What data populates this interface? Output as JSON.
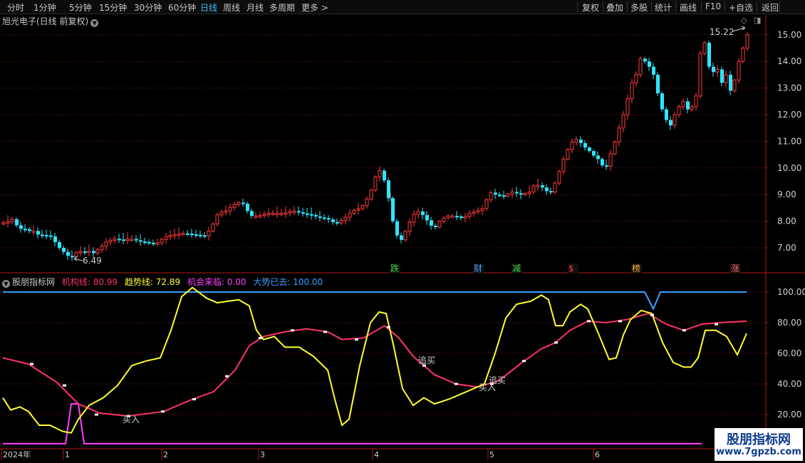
{
  "toolbar": {
    "left": [
      "分时",
      "1分钟",
      "5分钟",
      "15分钟",
      "30分钟",
      "60分钟",
      "日线",
      "周线",
      "月线",
      "多周期",
      "更多 >"
    ],
    "active_index": 6,
    "right": [
      "复权",
      "叠加",
      "多股",
      "统计",
      "画线",
      "F10",
      "+自选",
      "返回"
    ]
  },
  "main_title": "旭光电子(日线 前复权)",
  "price_axis": [
    "15.00",
    "14.00",
    "13.00",
    "12.00",
    "11.00",
    "10.00",
    "9.00",
    "8.00",
    "7.00"
  ],
  "annotations": {
    "high": "15.22",
    "low": "6.49"
  },
  "events": [
    {
      "label": "跌",
      "color": "#3fd04a"
    },
    {
      "label": "财",
      "color": "#4aa0ff"
    },
    {
      "label": "减",
      "color": "#3fd04a"
    },
    {
      "label": "$",
      "color": "#ff3b3b"
    },
    {
      "label": "榜",
      "color": "#ffb040"
    },
    {
      "label": "涨",
      "color": "#ff6060"
    }
  ],
  "indicator": {
    "name": "股朋指标网",
    "items": [
      {
        "label": "机构线: 80.99",
        "color": "#ff3366"
      },
      {
        "label": "趋势线: 72.89",
        "color": "#ffff30"
      },
      {
        "label": "机会来临: 0.00",
        "color": "#ff40ff"
      },
      {
        "label": "大势已去: 100.00",
        "color": "#3aa0ff"
      }
    ],
    "axis": [
      "100.00",
      "80.00",
      "60.00",
      "40.00",
      "20.00"
    ],
    "signals": [
      "买入",
      "追买",
      "买入",
      "追买"
    ]
  },
  "time_axis": [
    "2024年",
    "1",
    "2",
    "3",
    "4",
    "5",
    "6"
  ],
  "watermark": {
    "line1": "股朋指标网",
    "line2": "www.7gpzb.com"
  },
  "colors": {
    "up": "#ff3b3b",
    "down": "#2ee6ff",
    "grid": "#8a1a1a",
    "axis": "#b01818"
  }
}
